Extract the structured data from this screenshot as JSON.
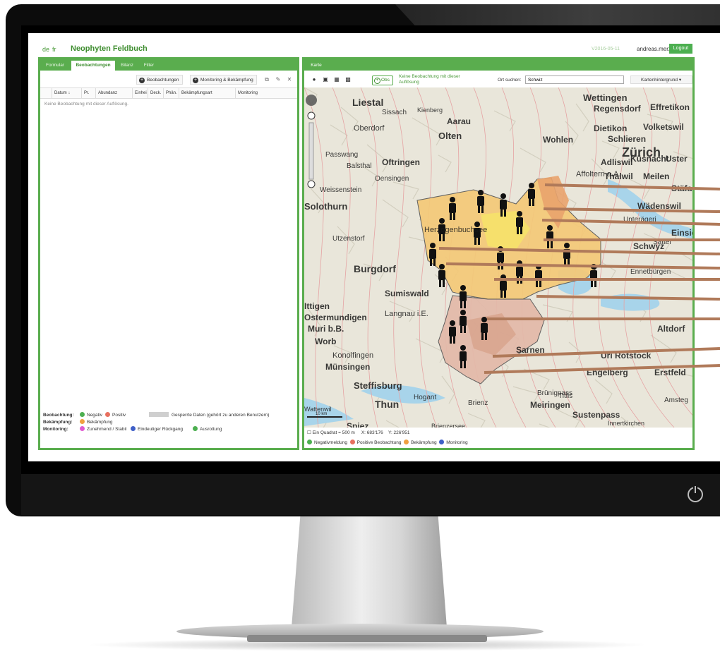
{
  "app": {
    "title": "Neophyten Feldbuch",
    "lang_de": "de",
    "lang_fr": "fr",
    "version": "V2016-05-11",
    "user": "andreas.merz",
    "logout": "Logout"
  },
  "left_tabs": [
    "Formular",
    "Beobachtungen",
    "Bilanz",
    "Filter"
  ],
  "left_active_tab": "Beobachtungen",
  "toolbar": {
    "add_observations": "Beobachtungen",
    "add_monitoring": "Monitoring & Bekämpfung"
  },
  "table": {
    "headers": [
      "Datum ↓",
      "Pr.",
      "Abundanz",
      "Einhei",
      "Deck.",
      "Phän.",
      "Bekämpfungsart",
      "Monitoring"
    ],
    "empty_message": "Keine Beobachtung mit dieser Auflösung."
  },
  "legend_left": {
    "beobachtung_label": "Beobachtung:",
    "negativ": "Negativ",
    "positiv": "Positiv",
    "gesperrt": "Gesperrte Daten (gehört zu anderen Benutzern)",
    "bekaempfung_label": "Bekämpfung:",
    "bekaempfung": "Bekämpfung",
    "monitoring_label": "Monitoring:",
    "zunehmend": "Zunehmend / Stabil",
    "rueckgang": "Eindeutiger Rückgang",
    "ausrottung": "Ausrottung"
  },
  "map_tab": "Karte",
  "map_toolbar": {
    "obs_button": "Obs",
    "no_obs": "Keine Beobachtung mit dieser Auflösung",
    "search_label": "Ort suchen:",
    "search_value": "Schwiz",
    "background": "Kartenhintergrund"
  },
  "map_footer": {
    "quadrat": "Ein Quadrat = 500 m",
    "x": "X: 683'176",
    "y": "Y: 226'951",
    "scale": "10 km"
  },
  "map_legend": {
    "negativ": "Negativmeldung",
    "positiv": "Positive Beobachtung",
    "bekaempfung": "Bekämpfung",
    "monitoring": "Monitoring"
  },
  "map_labels": [
    "Liestal",
    "Sissach",
    "Kienberg",
    "Aarau",
    "Oberdorf",
    "Olten",
    "Wettingen",
    "Regensdorf",
    "Effretikon",
    "Dietikon",
    "Schlieren",
    "Zürich",
    "Volketswil",
    "Wohlen",
    "Adliswil",
    "Küsnacht",
    "Uster",
    "Oftringen",
    "Passwang",
    "Balsthal",
    "Oensingen",
    "Affoltern a.A.",
    "Thalwil",
    "Meilen",
    "Stäfa",
    "Wädenswil",
    "Weissenstein",
    "Solothurn",
    "Herzogenbuchsee",
    "Utzenstorf",
    "Burgdorf",
    "Sumiswald",
    "Ittigen",
    "Ostermundigen",
    "Muri b.B.",
    "Worb",
    "Langnau i.E.",
    "Konolfingen",
    "Münsingen",
    "Steffisburg",
    "Thun",
    "Hogant",
    "Brienz",
    "Sarnen",
    "Altdorf",
    "Uri Rotstock",
    "Engelberg",
    "Erstfeld",
    "Meiringen",
    "Titlis",
    "Sustenpass",
    "Amsteg",
    "Brünigpass",
    "Wattenwil",
    "Innertkirchen",
    "Schwyz",
    "Einsie",
    "Sattel",
    "Unterägeri",
    "Spiez",
    "Ennetbürgen",
    "Brienzersee"
  ],
  "colors": {
    "brand_green": "#5aad4e",
    "negativ": "#4caf50",
    "positiv": "#e8705f",
    "bekaempfung": "#f0a040",
    "monitoring": "#3f5fc7",
    "zunehmend": "#e05ad1",
    "rueckgang": "#3f5fc7",
    "ausrottung": "#4caf50",
    "overlay_line": "#b07a5a"
  }
}
